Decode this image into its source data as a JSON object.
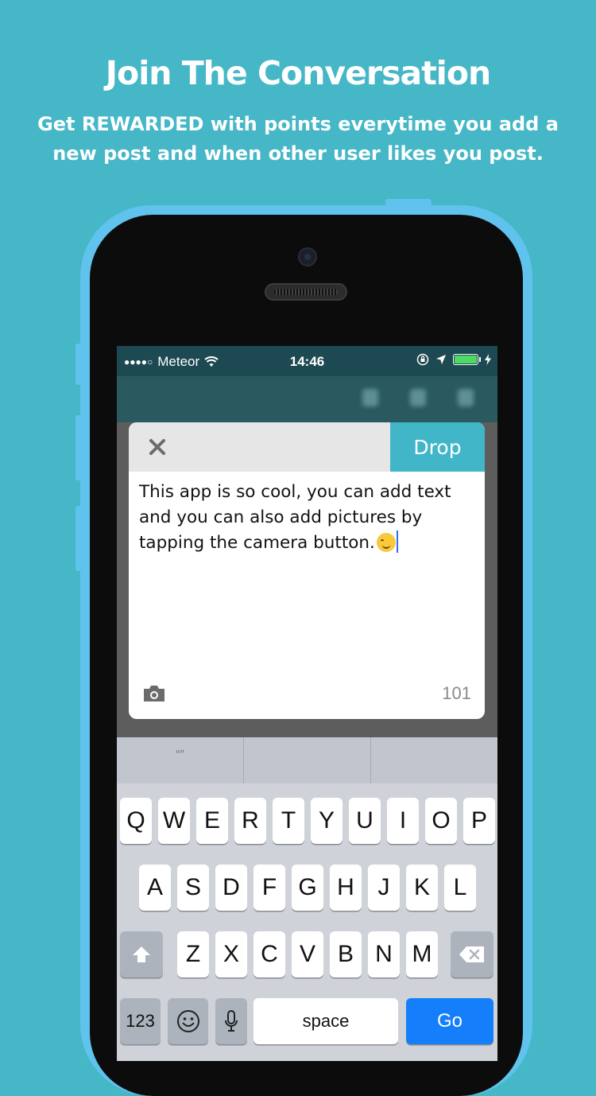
{
  "header": {
    "title": "Join The Conversation",
    "subtitle": "Get REWARDED with points everytime you add a new post and when other user likes you post."
  },
  "status_bar": {
    "carrier": "Meteor",
    "time": "14:46",
    "signal_icon": "signal-dots-icon",
    "wifi_icon": "wifi-icon",
    "battery_color": "#4cd964"
  },
  "compose": {
    "close_icon": "close-icon",
    "drop_label": "Drop",
    "post_text": "This app is so cool, you can add text and you can also add pictures by tapping the camera button.",
    "emoji": "smiling-face-emoji",
    "char_count": "101",
    "camera_icon": "camera-icon",
    "accent_color": "#41b6c8"
  },
  "keyboard": {
    "suggestions": [
      "“”",
      "",
      ""
    ],
    "row1": [
      "Q",
      "W",
      "E",
      "R",
      "T",
      "Y",
      "U",
      "I",
      "O",
      "P"
    ],
    "row2": [
      "A",
      "S",
      "D",
      "F",
      "G",
      "H",
      "J",
      "K",
      "L"
    ],
    "row3": [
      "Z",
      "X",
      "C",
      "V",
      "B",
      "N",
      "M"
    ],
    "numbers_label": "123",
    "space_label": "space",
    "go_label": "Go"
  }
}
